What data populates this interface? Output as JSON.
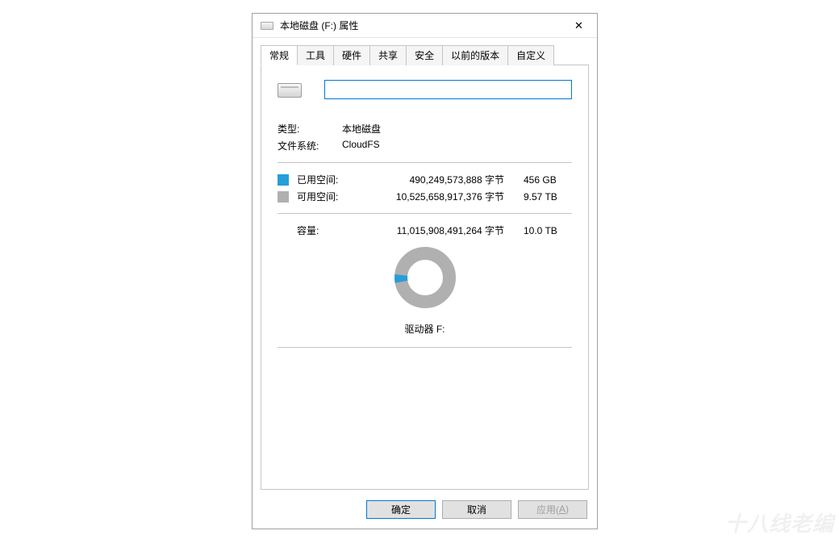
{
  "window": {
    "title": "本地磁盘 (F:) 属性"
  },
  "tabs": [
    "常规",
    "工具",
    "硬件",
    "共享",
    "安全",
    "以前的版本",
    "自定义"
  ],
  "active_tab": 0,
  "general": {
    "volume_name": "",
    "type_label": "类型:",
    "type_value": "本地磁盘",
    "fs_label": "文件系统:",
    "fs_value": "CloudFS",
    "used_label": "已用空间:",
    "used_bytes": "490,249,573,888 字节",
    "used_human": "456 GB",
    "free_label": "可用空间:",
    "free_bytes": "10,525,658,917,376 字节",
    "free_human": "9.57 TB",
    "cap_label": "容量:",
    "cap_bytes": "11,015,908,491,264 字节",
    "cap_human": "10.0 TB",
    "drive_caption": "驱动器 F:"
  },
  "buttons": {
    "ok": "确定",
    "cancel": "取消",
    "apply_prefix": "应用(",
    "apply_accel": "A",
    "apply_suffix": ")"
  },
  "chart_data": {
    "type": "pie",
    "title": "驱动器 F:",
    "series": [
      {
        "name": "已用空间",
        "value": 490249573888,
        "color": "#259ed9"
      },
      {
        "name": "可用空间",
        "value": 10525658917376,
        "color": "#b0b0b0"
      }
    ],
    "total": 11015908491264,
    "used_fraction": 0.0445
  },
  "watermark": "十八线老编"
}
